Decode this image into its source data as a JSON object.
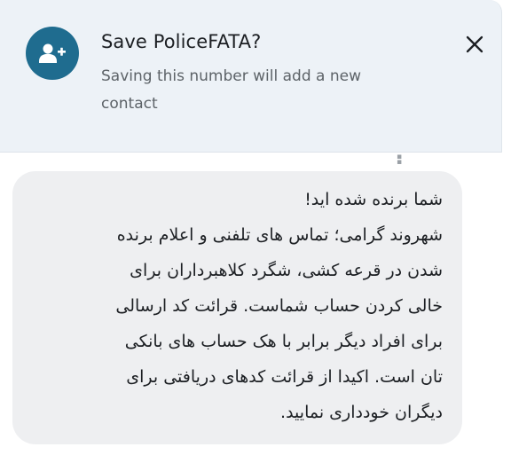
{
  "save_contact_banner": {
    "title": "Save PoliceFATA?",
    "subtitle": "Saving this number will add a new contact",
    "avatar_icon": "add-person-icon",
    "close_icon": "close-icon",
    "avatar_color": "#1f6c8f",
    "background_color": "#edf2f7"
  },
  "message": {
    "lines": [
      "شما برنده شده اید!",
      "شهروند گرامی؛ تماس های تلفنی و اعلام برنده",
      "شدن در قرعه کشی، شگرد کلاهبرداران برای",
      "خالی کردن حساب شماست. قرائت کد ارسالی",
      "برای افراد دیگر برابر با هک حساب های بانکی",
      "تان است. اکیدا از قرائت کدهای دریافتی برای",
      "دیگران خودداری نمایید."
    ],
    "bubble_color": "#eeeff1"
  }
}
